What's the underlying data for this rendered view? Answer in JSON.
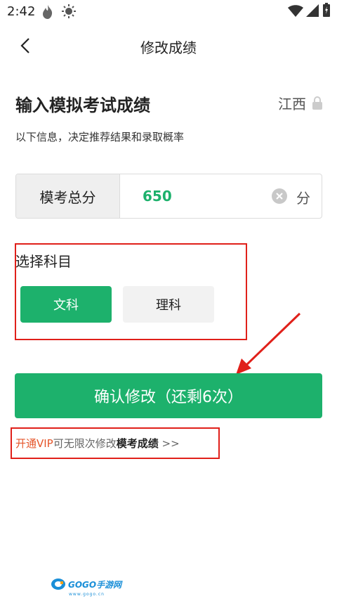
{
  "status_bar": {
    "time": "2:42"
  },
  "nav": {
    "title": "修改成绩"
  },
  "heading": "输入模拟考试成绩",
  "region": "江西",
  "subtitle": "以下信息，决定推荐结果和录取概率",
  "score": {
    "label": "模考总分",
    "value": "650",
    "unit": "分"
  },
  "subject": {
    "label": "选择科目",
    "options": [
      "文科",
      "理科"
    ],
    "selected": "文科"
  },
  "confirm_label": "确认修改（还剩6次）",
  "vip": {
    "link": "开通VIP",
    "mid": "可无限次修改",
    "strong": "模考成绩",
    "more": " >>"
  },
  "watermark": {
    "brand": "GOGO手游网",
    "url": "www.gogo.cn"
  },
  "colors": {
    "accent": "#1db16c",
    "highlight": "#e0201a",
    "vip": "#e5552a"
  }
}
